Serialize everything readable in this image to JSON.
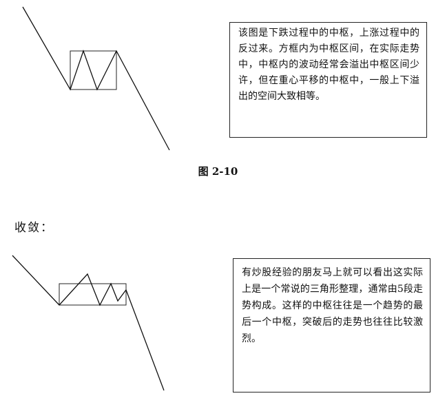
{
  "figure1": {
    "note": "该图是下跌过程中的中枢，上涨过程中的反过来。方框内为中枢区间，在实际走势中，中枢内的波动经常会溢出中枢区间少许，但在重心平移的中枢中，一般上下溢出的空间大致相等。",
    "caption": "图 2-10"
  },
  "section": {
    "heading": "收敛："
  },
  "figure2": {
    "note": "有炒股经验的朋友马上就可以看出这实际上是一个常说的三角形整理，通常由5段走势构成。这样的中枢往往是一个趋势的最后一个中枢，突破后的走势也往往比较激烈。"
  }
}
